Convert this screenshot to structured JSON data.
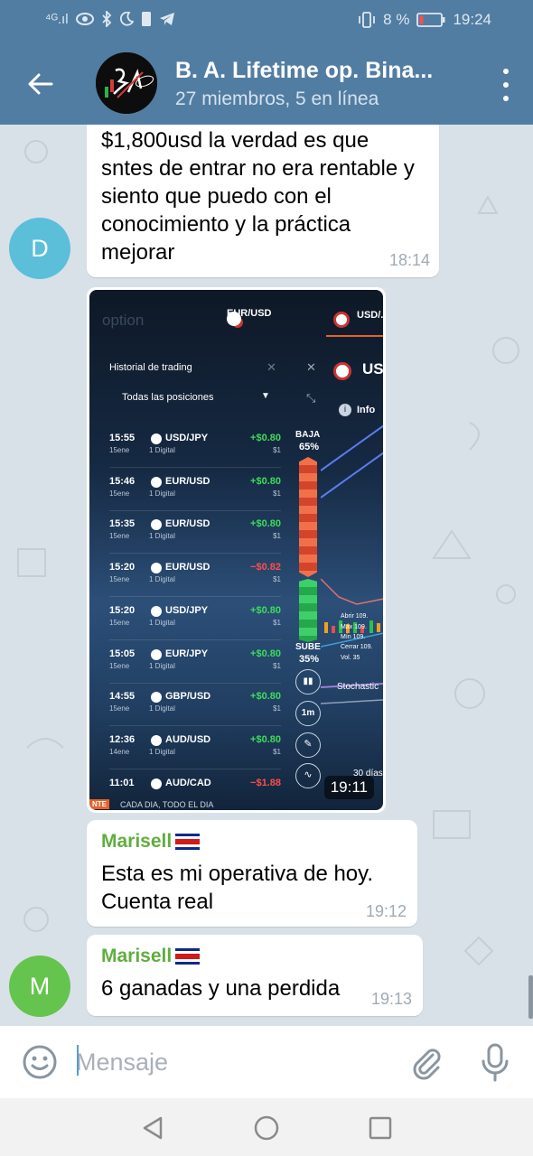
{
  "status_bar": {
    "network": "⁴ᴳ.ıl",
    "battery_percent": "8 %",
    "time": "19:24"
  },
  "header": {
    "title": "B. A. Lifetime op. Bina...",
    "subtitle": "27 miembros, 5 en línea",
    "avatar_text": "BA"
  },
  "messages": [
    {
      "avatar_letter": "D",
      "avatar_color": "#5bbfd9",
      "text": "$1,800usd la verdad es que sntes de entrar no era rentable y siento que puedo con el conocimiento y la práctica mejorar",
      "time": "18:14"
    },
    {
      "type": "photo",
      "time": "19:11",
      "screenshot": {
        "brand": "option",
        "tab1": "EUR/USD",
        "tab2": "USD/...",
        "panel_title": "Historial de trading",
        "filter": "Todas las posiciones",
        "asset_header": "USD",
        "info_label": "Info",
        "baja_label": "BAJA",
        "baja_pct": "65%",
        "sube_label": "SUBE",
        "sube_pct": "35%",
        "indicator": "Stochastic",
        "period": "30 días",
        "timeframe": "1m",
        "stats": {
          "abrir": "Abrir 109.",
          "max": "Máx 109.",
          "min": "Mín 109.",
          "cerrar": "Cerrar 109.",
          "vol": "Vol. 35"
        },
        "footer": "CADA DIA, TODO EL DIA",
        "footer_left": "NTE",
        "trades": [
          {
            "time": "15:55",
            "date": "15ene",
            "pair": "USD/JPY",
            "kind": "1 Digital",
            "amount": "+$0.80",
            "invest": "$1",
            "win": true
          },
          {
            "time": "15:46",
            "date": "15ene",
            "pair": "EUR/USD",
            "kind": "1 Digital",
            "amount": "+$0.80",
            "invest": "$1",
            "win": true
          },
          {
            "time": "15:35",
            "date": "15ene",
            "pair": "EUR/USD",
            "kind": "1 Digital",
            "amount": "+$0.80",
            "invest": "$1",
            "win": true
          },
          {
            "time": "15:20",
            "date": "15ene",
            "pair": "EUR/USD",
            "kind": "1 Digital",
            "amount": "−$0.82",
            "invest": "$1",
            "win": false
          },
          {
            "time": "15:20",
            "date": "15ene",
            "pair": "USD/JPY",
            "kind": "1 Digital",
            "amount": "+$0.80",
            "invest": "$1",
            "win": true
          },
          {
            "time": "15:05",
            "date": "15ene",
            "pair": "EUR/JPY",
            "kind": "1 Digital",
            "amount": "+$0.80",
            "invest": "$1",
            "win": true
          },
          {
            "time": "14:55",
            "date": "15ene",
            "pair": "GBP/USD",
            "kind": "1 Digital",
            "amount": "+$0.80",
            "invest": "$1",
            "win": true
          },
          {
            "time": "12:36",
            "date": "14ene",
            "pair": "AUD/USD",
            "kind": "1 Digital",
            "amount": "+$0.80",
            "invest": "$1",
            "win": true
          },
          {
            "time": "11:01",
            "date": "",
            "pair": "AUD/CAD",
            "kind": "",
            "amount": "−$1.88",
            "invest": "",
            "win": false
          }
        ]
      }
    },
    {
      "sender": "Marisell",
      "text": "Esta es mi operativa de hoy. Cuenta real",
      "time": "19:12"
    },
    {
      "avatar_letter": "M",
      "avatar_color": "#65c44d",
      "sender": "Marisell",
      "text": "6 ganadas y una perdida",
      "time": "19:13"
    }
  ],
  "input": {
    "placeholder": "Mensaje",
    "value": ""
  },
  "colors": {
    "header": "#527da3",
    "sender_name": "#5fae3f",
    "win": "#3ddc5b",
    "loss": "#ff4d4d"
  },
  "icons": [
    "back-arrow-icon",
    "more-vert-icon",
    "emoji-icon",
    "attach-icon",
    "mic-icon",
    "nav-back-icon",
    "nav-home-icon",
    "nav-recents-icon"
  ]
}
